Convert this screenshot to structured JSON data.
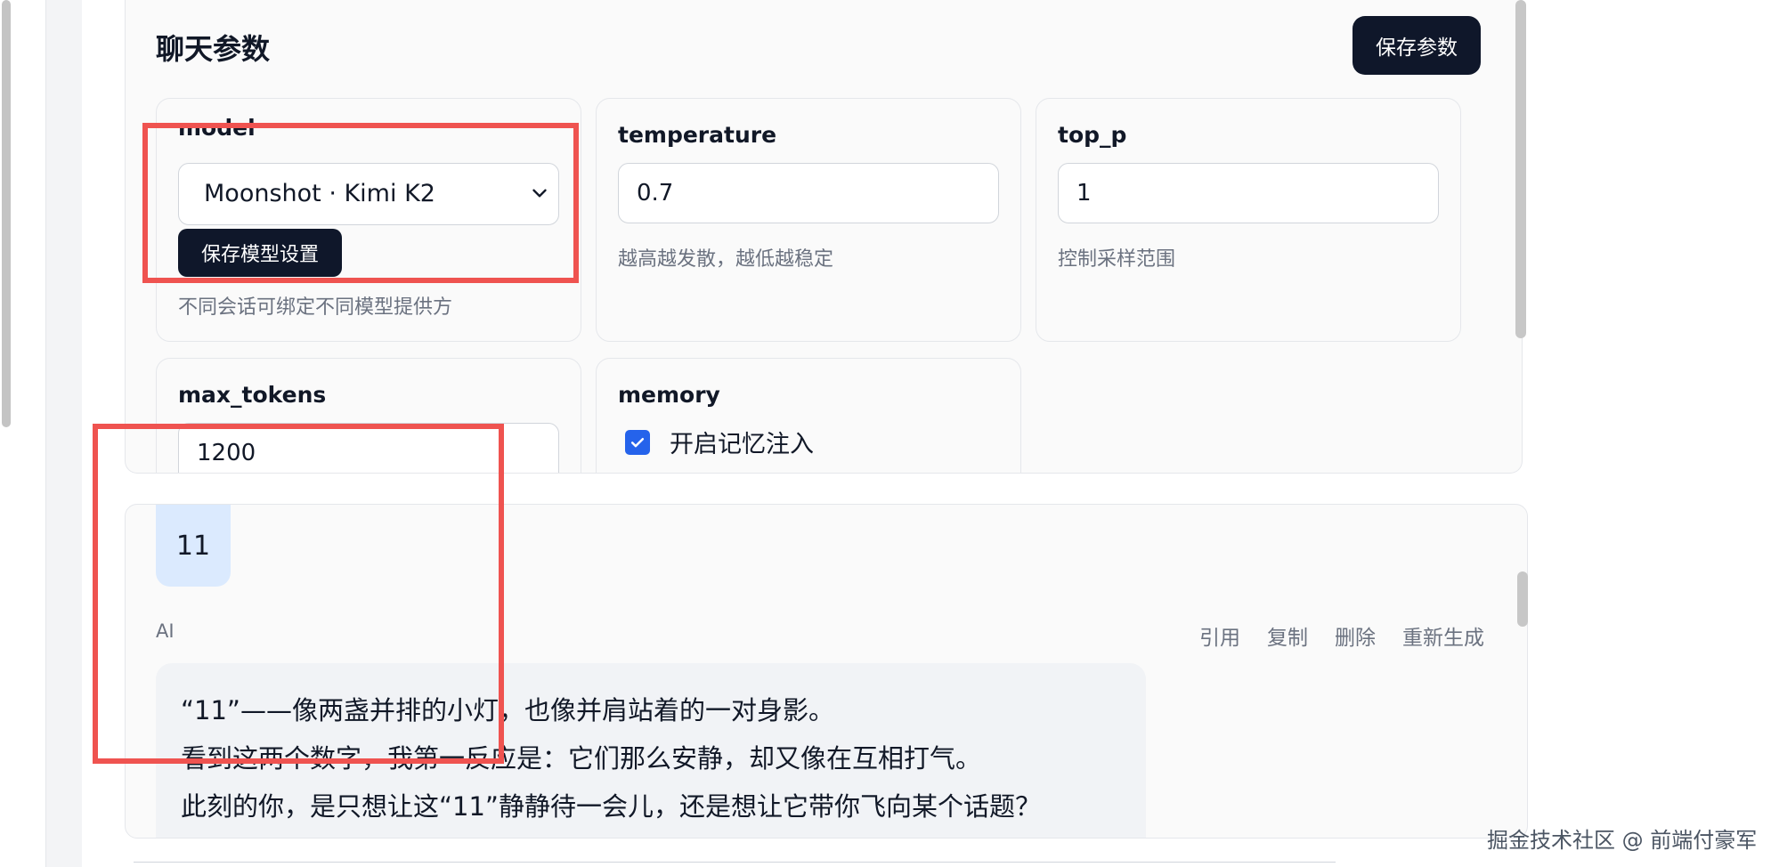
{
  "panel": {
    "title": "聊天参数",
    "save_button": "保存参数"
  },
  "cards": {
    "model": {
      "label": "model",
      "selected": "Moonshot · Kimi K2",
      "save_button": "保存模型设置",
      "hint": "不同会话可绑定不同模型提供方"
    },
    "temperature": {
      "label": "temperature",
      "value": "0.7",
      "hint": "越高越发散，越低越稳定"
    },
    "top_p": {
      "label": "top_p",
      "value": "1",
      "hint": "控制采样范围"
    },
    "max_tokens": {
      "label": "max_tokens",
      "value": "1200"
    },
    "memory": {
      "label": "memory",
      "checkbox_label": "开启记忆注入",
      "checked": true
    }
  },
  "chat": {
    "user_message": "11",
    "ai_label": "AI",
    "actions": [
      "引用",
      "复制",
      "删除",
      "重新生成"
    ],
    "ai_lines": [
      "“11”——像两盏并排的小灯，也像并肩站着的一对身影。",
      "看到这两个数字，我第一反应是：它们那么安静，却又像在互相打气。",
      "此刻的你，是只想让这“11”静静待一会儿，还是想让它带你飞向某个话题？"
    ]
  },
  "watermark": "掘金技术社区 @ 前端付豪军",
  "colors": {
    "button_dark": "#0f172a",
    "checkbox_blue": "#2563eb",
    "annotation_red": "#ef5350",
    "user_bubble": "#dbeafe"
  }
}
